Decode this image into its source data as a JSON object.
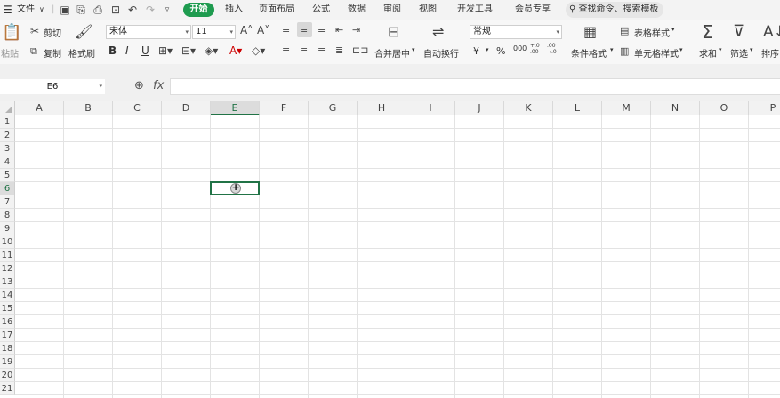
{
  "menubar": {
    "file_label": "文件",
    "tabs": [
      "开始",
      "插入",
      "页面布局",
      "公式",
      "数据",
      "审阅",
      "视图",
      "开发工具",
      "会员专享"
    ],
    "search_placeholder": "查找命令、搜索模板"
  },
  "ribbon": {
    "paste_label": "粘贴",
    "cut_label": "剪切",
    "copy_label": "复制",
    "format_painter_label": "格式刷",
    "font_name": "宋体",
    "font_size": "11",
    "bold_label": "B",
    "italic_label": "I",
    "underline_label": "U",
    "merge_label": "合并居中",
    "wrap_label": "自动换行",
    "number_format": "常规",
    "currency_symbol": "¥",
    "percent_symbol": "%",
    "thousands_symbol": "000",
    "inc_decimal": "+.0 .00",
    "dec_decimal": ".00 →.0",
    "conditional_label": "条件格式",
    "table_style_label": "表格样式",
    "cell_style_label": "单元格样式",
    "sum_label": "求和",
    "filter_label": "筛选",
    "sort_label": "排序"
  },
  "formula_bar": {
    "name_box": "E6",
    "fx_label": "fx",
    "value": ""
  },
  "grid": {
    "columns": [
      "A",
      "B",
      "C",
      "D",
      "E",
      "F",
      "G",
      "H",
      "I",
      "J",
      "K",
      "L",
      "M",
      "N",
      "O",
      "P"
    ],
    "rows": [
      "1",
      "2",
      "3",
      "4",
      "5",
      "6",
      "7",
      "8",
      "9",
      "10",
      "11",
      "12",
      "13",
      "14",
      "15",
      "16",
      "17",
      "18",
      "19",
      "20",
      "21"
    ],
    "active_column": "E",
    "active_row": "6"
  },
  "colors": {
    "accent": "#1e9b4f",
    "selection": "#217346"
  }
}
